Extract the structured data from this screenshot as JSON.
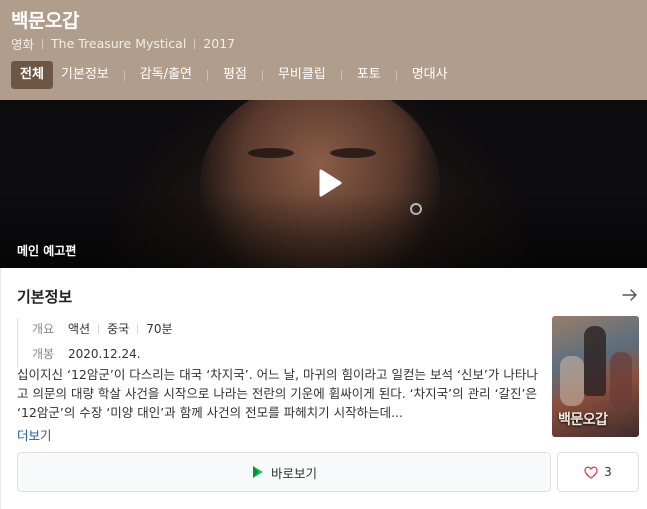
{
  "header": {
    "title": "백문오갑",
    "category": "영화",
    "original_title": "The Treasure Mystical",
    "year": "2017",
    "tabs": [
      {
        "label": "전체",
        "active": true
      },
      {
        "label": "기본정보",
        "active": false
      },
      {
        "label": "감독/출연",
        "active": false
      },
      {
        "label": "평점",
        "active": false
      },
      {
        "label": "무비클립",
        "active": false
      },
      {
        "label": "포토",
        "active": false
      },
      {
        "label": "명대사",
        "active": false
      }
    ],
    "bg_color": "#b09d8b",
    "active_tab_color": "#6d5744"
  },
  "video": {
    "label": "메인 예고편",
    "play_icon": "play-icon"
  },
  "basic_info": {
    "section_title": "기본정보",
    "arrow_icon": "arrow-right-icon",
    "overview_key": "개요",
    "genre": "액션",
    "country": "중국",
    "runtime": "70분",
    "release_key": "개봉",
    "release_date": "2020.12.24.",
    "synopsis": "십이지신 ‘12암군’이 다스리는 대국 ‘차지국’. 어느 날, 마귀의 힘이라고 일컫는 보석 ‘신보’가 나타나고 의문의 대량 학살 사건을 시작으로 나라는 전란의 기운에 휩싸이게 된다. ‘차지국’의 관리 ‘갈진’은 ‘12암군’의 수장 ‘미양 대인’과 함께 사건의 전모를 파헤치기 시작하는데...",
    "more_label": "더보기",
    "poster_title": "백문오갑"
  },
  "actions": {
    "watch_label": "바로보기",
    "watch_icon": "play-store-icon",
    "like_icon": "heart-icon",
    "like_count": "3",
    "like_color": "#e0485a"
  }
}
